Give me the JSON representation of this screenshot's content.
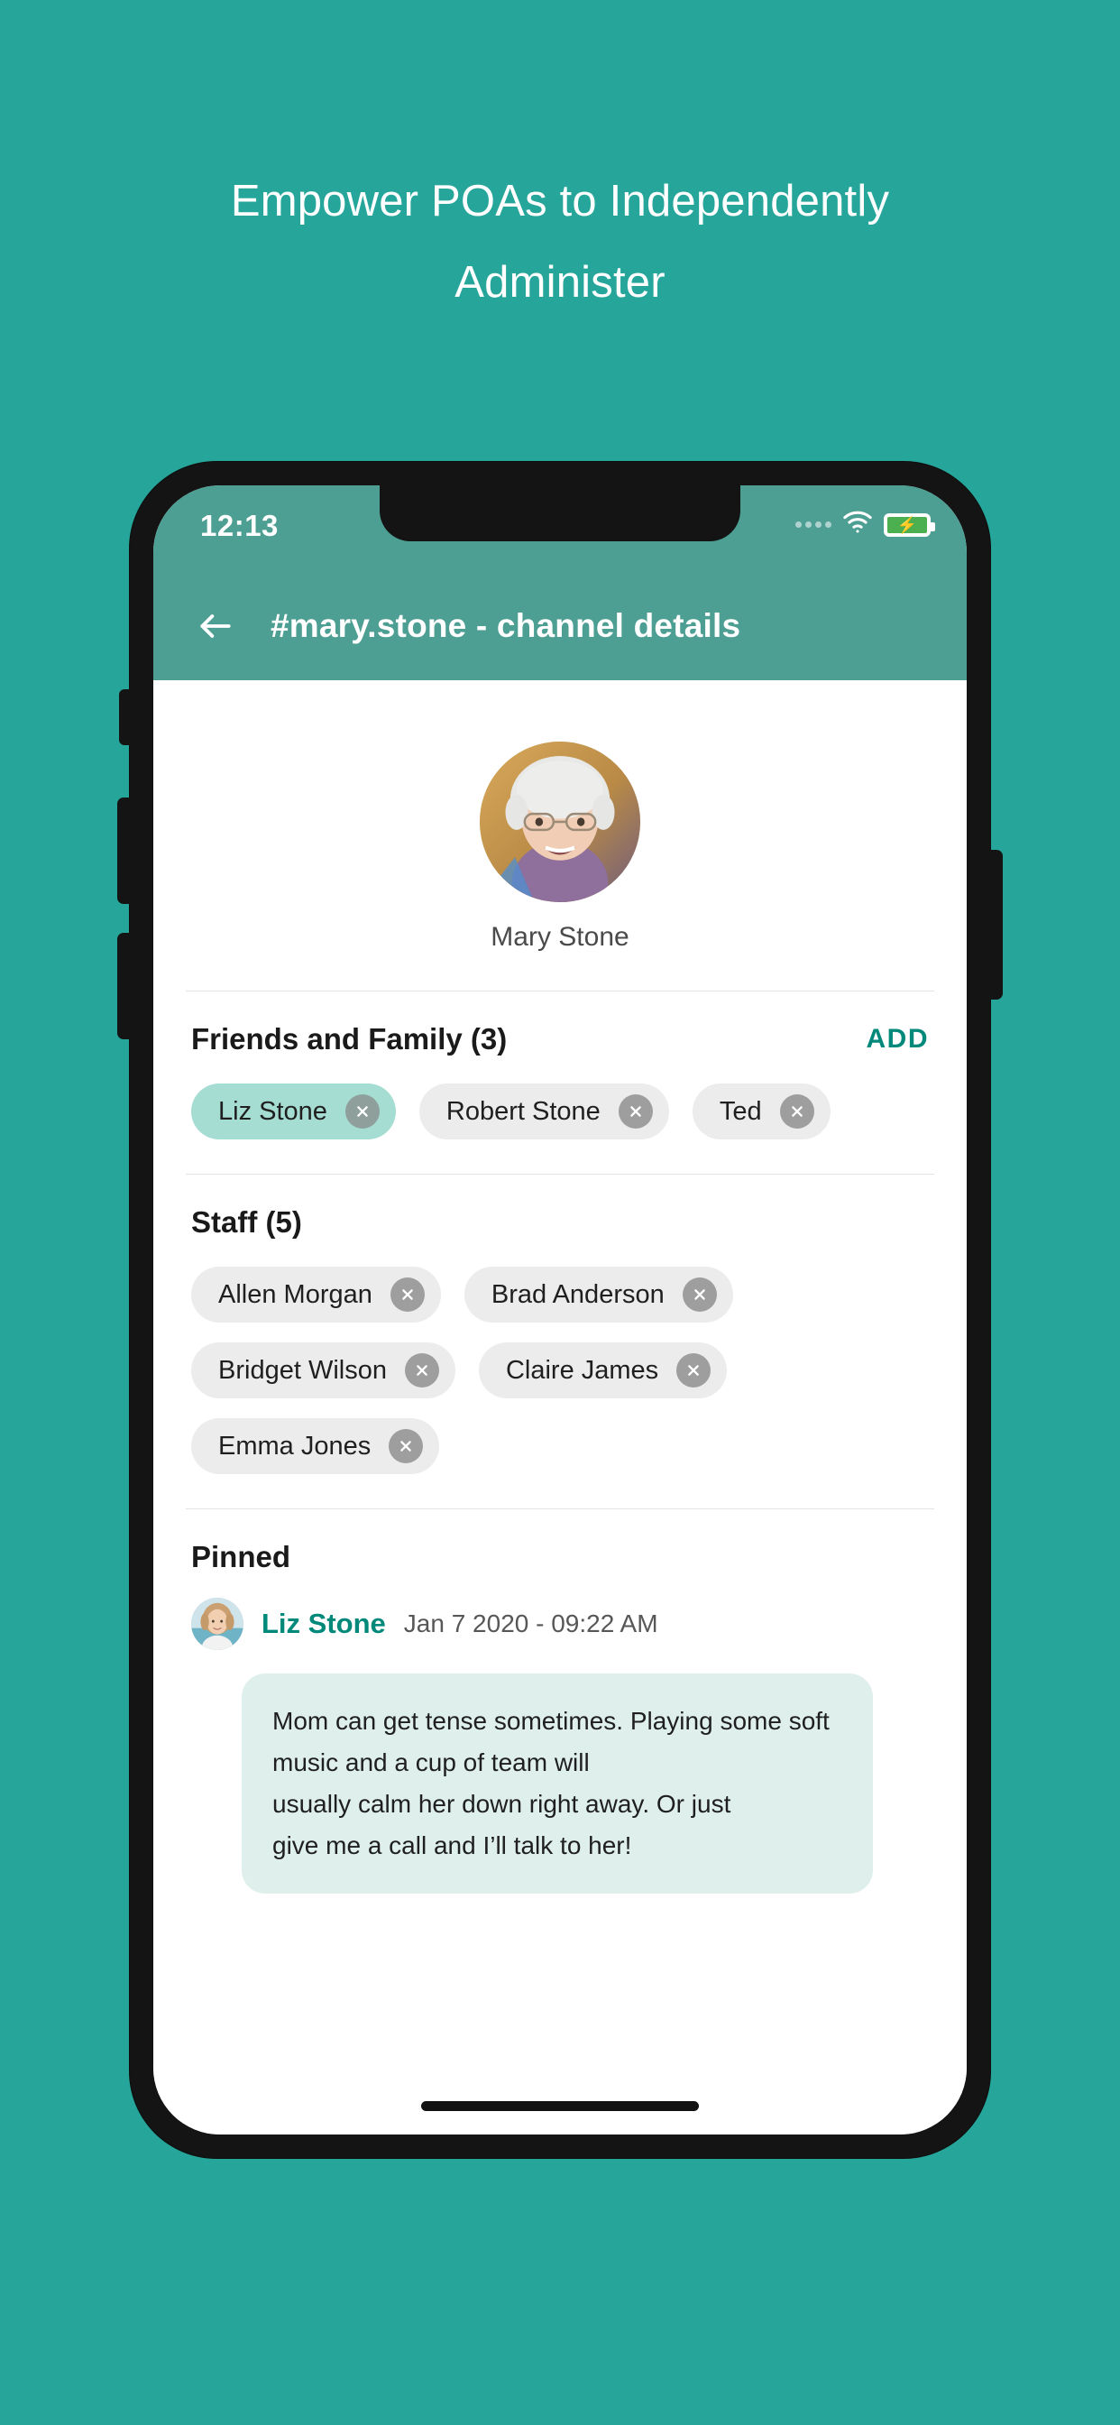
{
  "theme": {
    "background": "#26a69a",
    "appbar": "#4d9e93",
    "accent": "#00897b",
    "chip_selected": "#a5ddd3",
    "chip_default": "#ececec",
    "bubble": "#dff0ec"
  },
  "promo": {
    "headline": "Empower POAs to Independently Administer"
  },
  "statusbar": {
    "time": "12:13",
    "signal_icon": "signal-dots-icon",
    "wifi_icon": "wifi-icon",
    "battery_icon": "battery-charging-icon"
  },
  "appbar": {
    "back_icon": "back-arrow-icon",
    "title": "#mary.stone - channel details"
  },
  "profile": {
    "avatar_icon": "mary-stone-avatar",
    "name": "Mary Stone"
  },
  "friends_section": {
    "title": "Friends and Family (3)",
    "add_label": "ADD",
    "chips": [
      {
        "label": "Liz Stone",
        "selected": true
      },
      {
        "label": "Robert Stone",
        "selected": false
      },
      {
        "label": "Ted",
        "selected": false
      }
    ]
  },
  "staff_section": {
    "title": "Staff (5)",
    "chips": [
      {
        "label": "Allen Morgan",
        "selected": false
      },
      {
        "label": "Brad Anderson",
        "selected": false
      },
      {
        "label": "Bridget Wilson",
        "selected": false
      },
      {
        "label": "Claire James",
        "selected": false
      },
      {
        "label": "Emma Jones",
        "selected": false
      }
    ]
  },
  "pinned": {
    "title": "Pinned",
    "message": {
      "avatar_icon": "liz-stone-avatar",
      "author": "Liz Stone",
      "timestamp": "Jan 7 2020 - 09:22 AM",
      "lines": [
        "Mom can get tense sometimes. Playing some soft",
        "music and a cup of team will",
        "usually calm her down right away. Or just",
        "give me a call and I’ll talk to her!"
      ]
    }
  },
  "home_indicator": "home-indicator"
}
